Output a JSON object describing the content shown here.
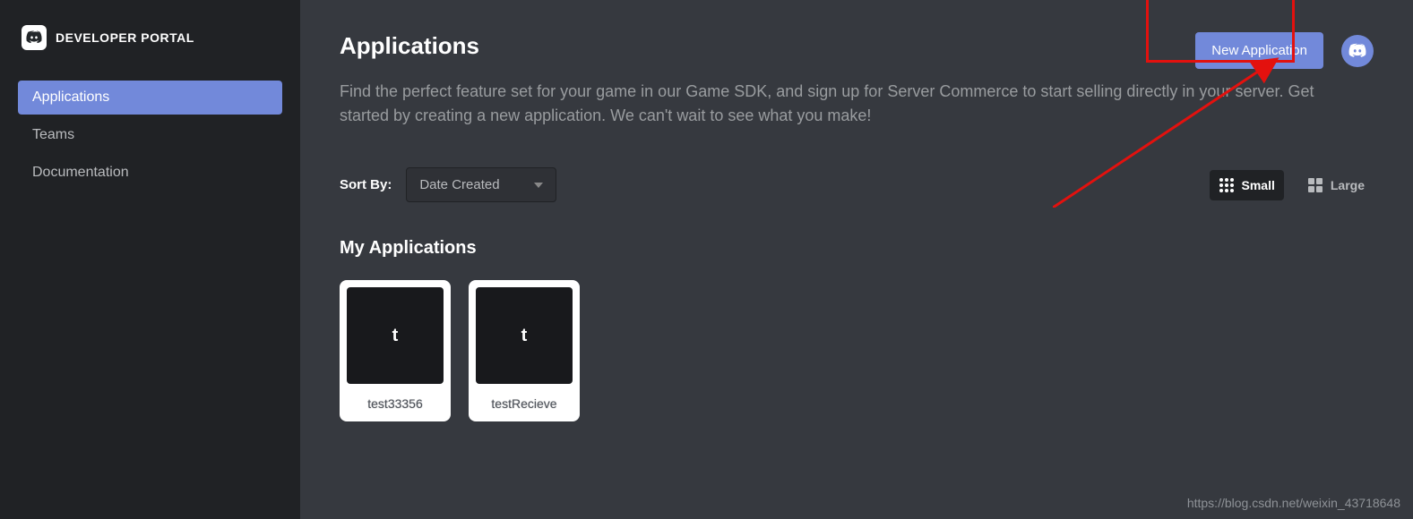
{
  "brand": {
    "title": "DEVELOPER PORTAL"
  },
  "sidebar": {
    "items": [
      {
        "label": "Applications",
        "active": true
      },
      {
        "label": "Teams",
        "active": false
      },
      {
        "label": "Documentation",
        "active": false
      }
    ]
  },
  "header": {
    "title": "Applications",
    "new_app": "New Application",
    "description": "Find the perfect feature set for your game in our Game SDK, and sign up for Server Commerce to start selling directly in your server. Get started by creating a new application. We can't wait to see what you make!"
  },
  "sort": {
    "label": "Sort By:",
    "selected": "Date Created"
  },
  "view": {
    "small": "Small",
    "large": "Large"
  },
  "section": {
    "my_apps": "My Applications"
  },
  "apps": [
    {
      "initial": "t",
      "name": "test33356"
    },
    {
      "initial": "t",
      "name": "testRecieve"
    }
  ],
  "colors": {
    "accent": "#7289da",
    "highlight": "#e3110e"
  },
  "watermark": "https://blog.csdn.net/weixin_43718648"
}
